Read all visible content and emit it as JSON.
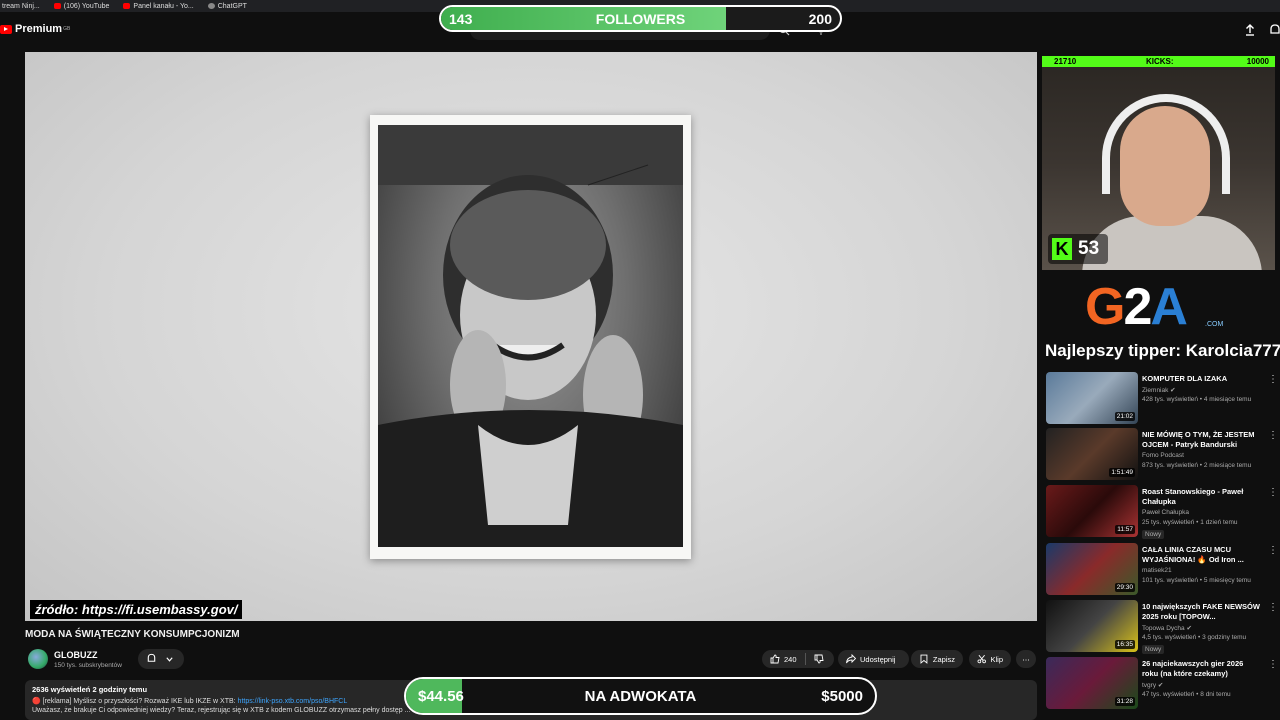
{
  "bookmarks": [
    "tream Ninj...",
    "(106) YouTube",
    "Panel kanału - Yo...",
    "ChatGPT"
  ],
  "header": {
    "logo_label": "Premium",
    "logo_sup": "GB"
  },
  "followers_bar": {
    "current": "143",
    "title": "FOLLOWERS",
    "goal": "200",
    "progress": 0.715
  },
  "video": {
    "source_label": "źródło: https://fi.usembassy.gov/",
    "title": "MODA NA ŚWIĄTECZNY KONSUMPCJONIZM"
  },
  "channel": {
    "name": "GLOBUZZ",
    "subscribers": "150 tys. subskrybentów"
  },
  "actions": {
    "likes": "240",
    "share": "Udostępnij",
    "save": "Zapisz",
    "clip": "Klip",
    "more": "⋯"
  },
  "description": {
    "meta": "2636 wyświetleń  2 godziny temu",
    "line1_prefix": "🔴 [reklama] Myślisz o przyszłości? Rozważ IKE lub IKZE w XTB: ",
    "line1_link": "https://link-pso.xtb.com/pso/BHFCL",
    "line2": "Uważasz, że brakuje Ci odpowiedniej wiedzy? Teraz, rejestrując się w XTB z kodem GLOBUZZ otrzymasz pełny dostęp ... racyjny dedykowany początkującym inwestorom | Inwestowanie jest ryzykowne. Inwestuj odpowiedzialnie."
  },
  "donation_bar": {
    "current": "$44.56",
    "title": "NA ADWOKATA",
    "goal": "$5000",
    "progress": 0.009
  },
  "webcam": {
    "kicks_left": "21710",
    "kicks_label": "KICKS:",
    "kicks_right": "10000",
    "kick_count": "53"
  },
  "sponsor": {
    "logo_g": "G",
    "logo_2": "2",
    "logo_a": "A",
    "logo_com": ".COM",
    "tipper": "Najlepszy tipper: Karolcia777"
  },
  "recommendations": [
    {
      "title": "KOMPUTER DLA IZAKA",
      "channel": "Ziemniak ✔",
      "meta": "428 tys. wyświetleń • 4 miesiące temu",
      "duration": "21:02",
      "badge": ""
    },
    {
      "title": "NIE MÓWIĘ O TYM, ŻE JESTEM OJCEM - Patryk Bandurski",
      "channel": "Fomo Podcast",
      "meta": "873 tys. wyświetleń • 2 miesiące temu",
      "duration": "1:51:49",
      "badge": ""
    },
    {
      "title": "Roast Stanowskiego - Paweł Chałupka",
      "channel": "Paweł Chałupka",
      "meta": "25 tys. wyświetleń • 1 dzień temu",
      "duration": "11:57",
      "badge": "Nowy"
    },
    {
      "title": "CAŁA LINIA CZASU MCU WYJAŚNIONA! 🔥 Od Iron ...",
      "channel": "matisek21",
      "meta": "101 tys. wyświetleń • 5 miesięcy temu",
      "duration": "29:30",
      "badge": ""
    },
    {
      "title": "10 największych FAKE NEWSÓW 2025 roku [TOPOW...",
      "channel": "Topowa Dycha ✔",
      "meta": "4,5 tys. wyświetleń • 3 godziny temu",
      "duration": "16:35",
      "badge": "Nowy"
    },
    {
      "title": "26 najciekawszych gier 2026 roku (na które czekamy)",
      "channel": "tvgry ✔",
      "meta": "47 tys. wyświetleń • 8 dni temu",
      "duration": "31:28",
      "badge": ""
    }
  ]
}
